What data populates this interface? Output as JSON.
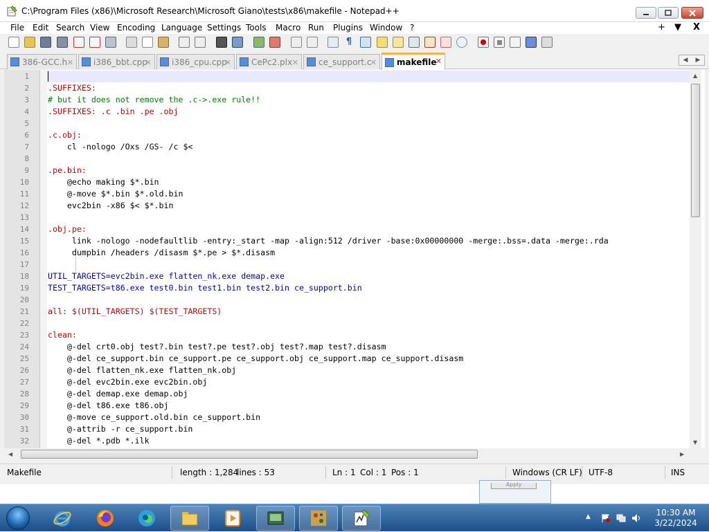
{
  "window": {
    "title": "C:\\Program Files (x86)\\Microsoft Research\\Microsoft Giano\\tests\\x86\\makefile - Notepad++",
    "icon": "notepad-icon"
  },
  "menu": {
    "items": [
      "File",
      "Edit",
      "Search",
      "View",
      "Encoding",
      "Language",
      "Settings",
      "Tools",
      "Macro",
      "Run",
      "Plugins",
      "Window",
      "?"
    ],
    "right": [
      "+",
      "▼",
      "X"
    ]
  },
  "toolbar": {
    "icons": [
      "new-file-icon",
      "open-file-icon",
      "save-icon",
      "save-all-icon",
      "close-icon",
      "close-all-icon",
      "print-icon",
      "cut-icon",
      "copy-icon",
      "paste-icon",
      "undo-icon",
      "redo-icon",
      "find-icon",
      "replace-icon",
      "zoom-in-icon",
      "zoom-out-icon",
      "sync-vertical-icon",
      "sync-horizontal-icon",
      "word-wrap-icon",
      "show-all-chars-icon",
      "indent-guide-icon",
      "user-language-icon",
      "doc-map-icon",
      "function-list-icon",
      "folder-workspace-icon",
      "monitoring-icon",
      "record-macro-icon",
      "stop-macro-icon",
      "play-macro-icon",
      "run-macro-multiple-icon",
      "save-macro-icon"
    ]
  },
  "tabs": [
    {
      "label": "386-GCC.h",
      "active": false
    },
    {
      "label": "i386_bbt.cpp",
      "active": false
    },
    {
      "label": "i386_cpu.cpp",
      "active": false
    },
    {
      "label": "CePc2.plx",
      "active": false
    },
    {
      "label": "ce_support.c",
      "active": false
    },
    {
      "label": "makefile",
      "active": true
    }
  ],
  "editor": {
    "lines": [
      {
        "n": "1",
        "text": "",
        "cls": ""
      },
      {
        "n": "2",
        "text": ".SUFFIXES:",
        "cls": "target"
      },
      {
        "n": "3",
        "text": "# but it does not remove the .c->.exe rule!!",
        "cls": "comment"
      },
      {
        "n": "4",
        "text": ".SUFFIXES: .c .bin .pe .obj",
        "cls": "target"
      },
      {
        "n": "5",
        "text": "",
        "cls": ""
      },
      {
        "n": "6",
        "text": ".c.obj:",
        "cls": "target"
      },
      {
        "n": "7",
        "text": "    cl -nologo /Oxs /GS- /c $<",
        "cls": ""
      },
      {
        "n": "8",
        "text": "",
        "cls": ""
      },
      {
        "n": "9",
        "text": ".pe.bin:",
        "cls": "target"
      },
      {
        "n": "10",
        "text": "    @echo making $*.bin",
        "cls": ""
      },
      {
        "n": "11",
        "text": "    @-move $*.bin $*.old.bin",
        "cls": ""
      },
      {
        "n": "12",
        "text": "    evc2bin -x86 $< $*.bin",
        "cls": ""
      },
      {
        "n": "13",
        "text": "",
        "cls": ""
      },
      {
        "n": "14",
        "text": ".obj.pe:",
        "cls": "target"
      },
      {
        "n": "15",
        "text": "     link -nologo -nodefaultlib -entry:_start -map -align:512 /driver -base:0x00000000 -merge:.bss=.data -merge:.rda",
        "cls": ""
      },
      {
        "n": "16",
        "text": "     dumpbin /headers /disasm $*.pe > $*.disasm",
        "cls": ""
      },
      {
        "n": "17",
        "text": "",
        "cls": ""
      },
      {
        "n": "18",
        "text": "UTIL_TARGETS=evc2bin.exe flatten_nk.exe demap.exe",
        "cls": "macro"
      },
      {
        "n": "19",
        "text": "TEST_TARGETS=t86.exe test0.bin test1.bin test2.bin ce_support.bin",
        "cls": "macro"
      },
      {
        "n": "20",
        "text": "",
        "cls": ""
      },
      {
        "n": "21",
        "text": "all: $(UTIL_TARGETS) $(TEST_TARGETS)",
        "cls": "target"
      },
      {
        "n": "22",
        "text": "",
        "cls": ""
      },
      {
        "n": "23",
        "text": "clean:",
        "cls": "target"
      },
      {
        "n": "24",
        "text": "    @-del crt0.obj test?.bin test?.pe test?.obj test?.map test?.disasm",
        "cls": ""
      },
      {
        "n": "25",
        "text": "    @-del ce_support.bin ce_support.pe ce_support.obj ce_support.map ce_support.disasm",
        "cls": ""
      },
      {
        "n": "26",
        "text": "    @-del flatten_nk.exe flatten_nk.obj",
        "cls": ""
      },
      {
        "n": "27",
        "text": "    @-del evc2bin.exe evc2bin.obj",
        "cls": ""
      },
      {
        "n": "28",
        "text": "    @-del demap.exe demap.obj",
        "cls": ""
      },
      {
        "n": "29",
        "text": "    @-del t86.exe t86.obj",
        "cls": ""
      },
      {
        "n": "30",
        "text": "    @-move ce_support.old.bin ce_support.bin",
        "cls": ""
      },
      {
        "n": "31",
        "text": "    @-attrib -r ce_support.bin",
        "cls": ""
      },
      {
        "n": "32",
        "text": "    @-del *.pdb *.ilk",
        "cls": ""
      }
    ]
  },
  "status": {
    "filetype": "Makefile",
    "length": "length : 1,284",
    "lines": "lines : 53",
    "ln": "Ln : 1",
    "col": "Col : 1",
    "pos": "Pos : 1",
    "eol": "Windows (CR LF)",
    "encoding": "UTF-8",
    "mode": "INS"
  },
  "background_window": {
    "button": "Apply"
  },
  "taskbar": {
    "apps": [
      "start-orb",
      "internet-explorer-icon",
      "firefox-icon",
      "edge-icon",
      "file-explorer-icon",
      "media-player-icon",
      "giano-app-icon",
      "paint-icon",
      "notepad-plus-plus-icon"
    ],
    "time": "10:30 AM",
    "date": "3/22/2024"
  },
  "colors": {
    "target": "#c80000",
    "comment": "#008000",
    "macro": "#0000c8",
    "active_tab_accent": "#fab042",
    "current_line": "#e8e8ff"
  }
}
